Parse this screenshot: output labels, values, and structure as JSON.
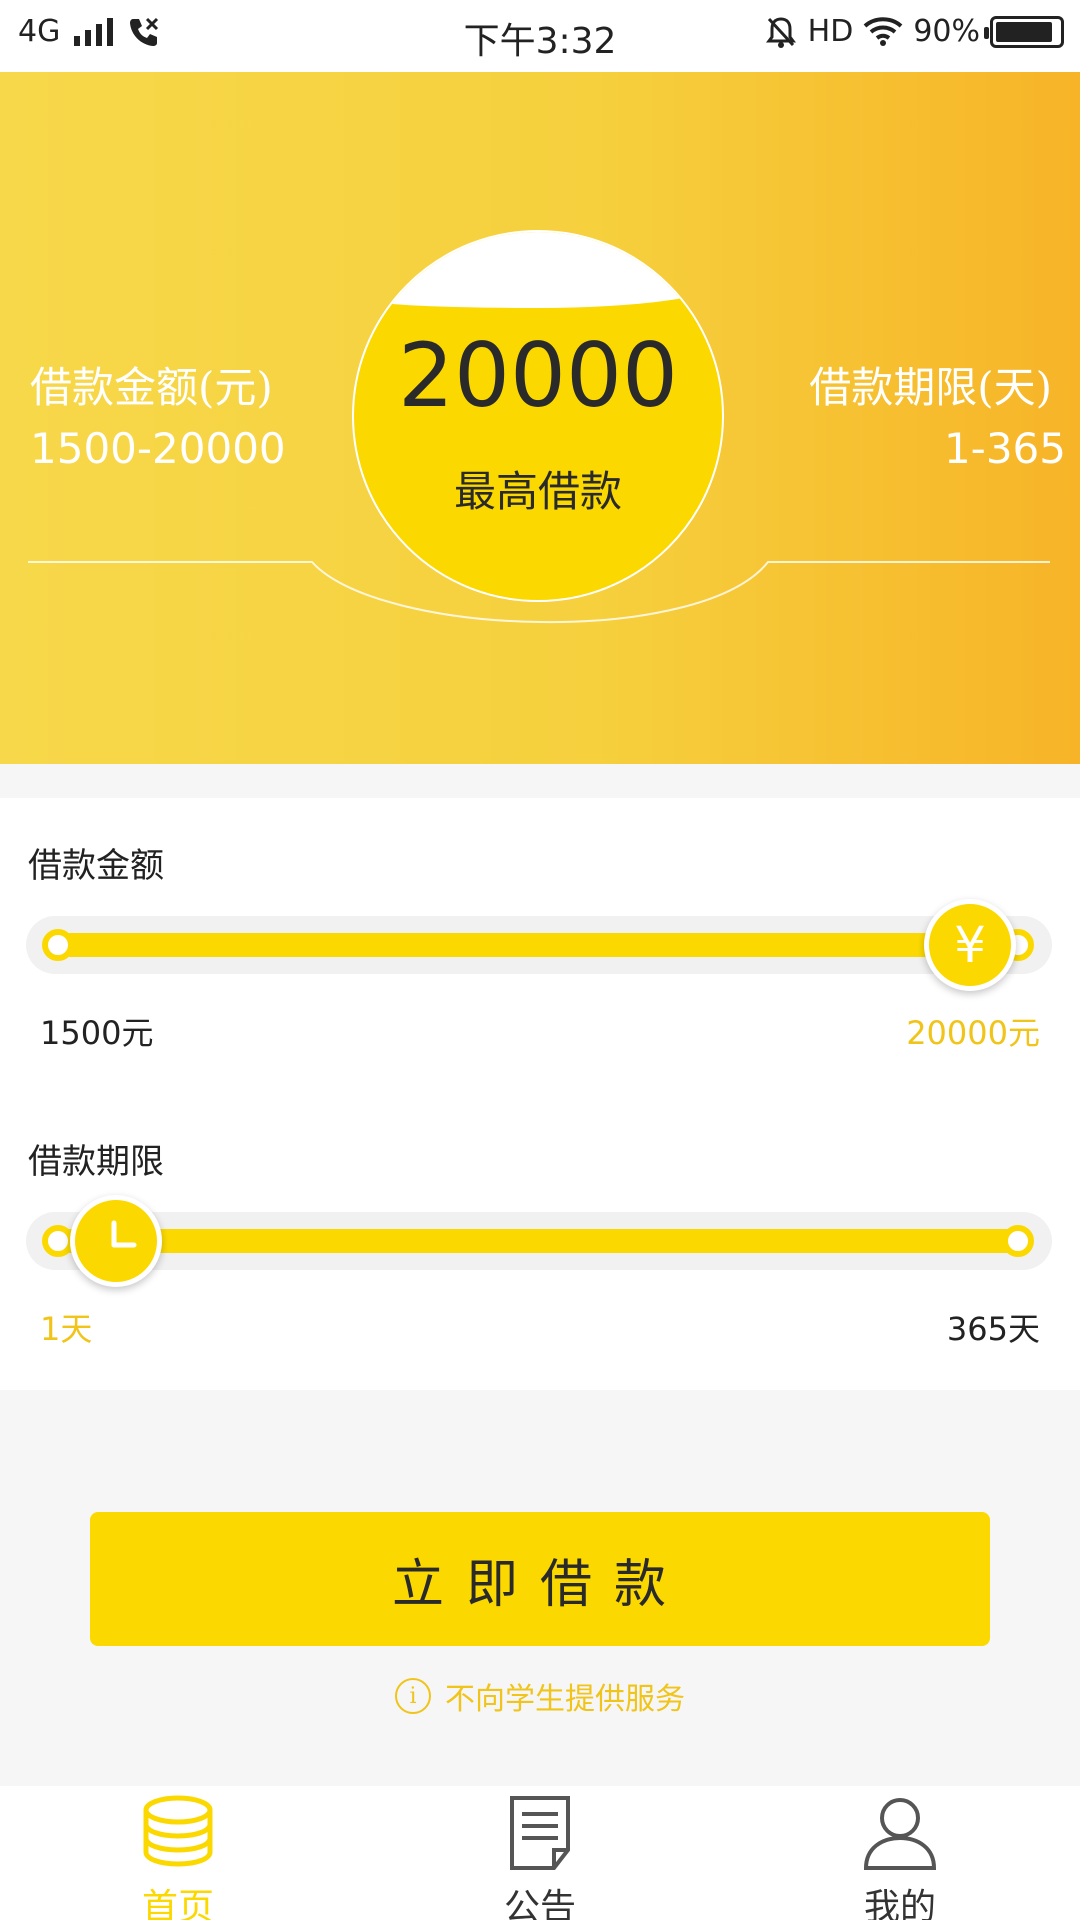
{
  "status_bar": {
    "network": "4G",
    "time": "下午3:32",
    "hd": "HD",
    "battery": "90%"
  },
  "hero": {
    "left_label": "借款金额(元)",
    "left_value": "1500-20000",
    "right_label": "借款期限(天)",
    "right_value": "1-365",
    "max_amount": "20000",
    "max_caption": "最高借款"
  },
  "amount_slider": {
    "title": "借款金额",
    "min_label": "1500元",
    "max_label": "20000元",
    "position_percent": 100,
    "knob_symbol": "¥"
  },
  "term_slider": {
    "title": "借款期限",
    "min_label": "1天",
    "max_label": "365天",
    "position_percent": 0
  },
  "primary_button": {
    "label": "立即借款"
  },
  "notice": {
    "icon": "i",
    "text": "不向学生提供服务"
  },
  "tabs": [
    {
      "label": "首页",
      "icon": "coins-icon",
      "active": true
    },
    {
      "label": "公告",
      "icon": "document-icon",
      "active": false
    },
    {
      "label": "我的",
      "icon": "user-icon",
      "active": false
    }
  ],
  "colors": {
    "accent": "#fbd900",
    "accent_text": "#f0c419",
    "hero_gradient_start": "#f7d84a",
    "hero_gradient_end": "#f7b428",
    "tab_inactive": "#555555"
  }
}
